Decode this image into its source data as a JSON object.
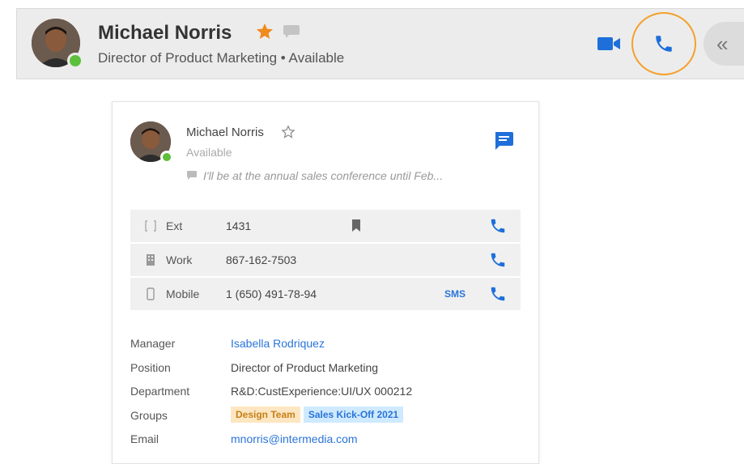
{
  "header": {
    "name": "Michael Norris",
    "subtitle": "Director of Product Marketing • Available",
    "collapse_glyph": "«",
    "icons": {
      "favorite": "star-filled-icon",
      "chat": "chat-bubble-icon",
      "video": "video-camera-icon",
      "call": "phone-icon",
      "collapse": "double-chevron-left-icon"
    }
  },
  "card": {
    "name": "Michael Norris",
    "presence": "Available",
    "status_message": "I'll be at the annual sales conference until Feb...",
    "phones": [
      {
        "label": "Ext",
        "value": "1431",
        "icon": "extension-icon",
        "extra_icon": "bookmark-icon"
      },
      {
        "label": "Work",
        "value": "867-162-7503",
        "icon": "building-icon"
      },
      {
        "label": "Mobile",
        "value": "1 (650) 491-78-94",
        "icon": "mobile-phone-icon",
        "sms": "SMS"
      }
    ],
    "details": {
      "manager_label": "Manager",
      "manager_value": "Isabella Rodriquez",
      "position_label": "Position",
      "position_value": "Director of Product Marketing",
      "department_label": "Department",
      "department_value": "R&D:CustExperience:UI/UX 000212",
      "groups_label": "Groups",
      "groups": [
        "Design Team",
        "Sales Kick-Off 2021"
      ],
      "email_label": "Email",
      "email_value": "mnorris@intermedia.com"
    }
  },
  "colors": {
    "accent_blue": "#2a74d8",
    "favorite_orange": "#f08a1c",
    "call_ring": "#f5a02a",
    "presence_green": "#5cc03a"
  }
}
